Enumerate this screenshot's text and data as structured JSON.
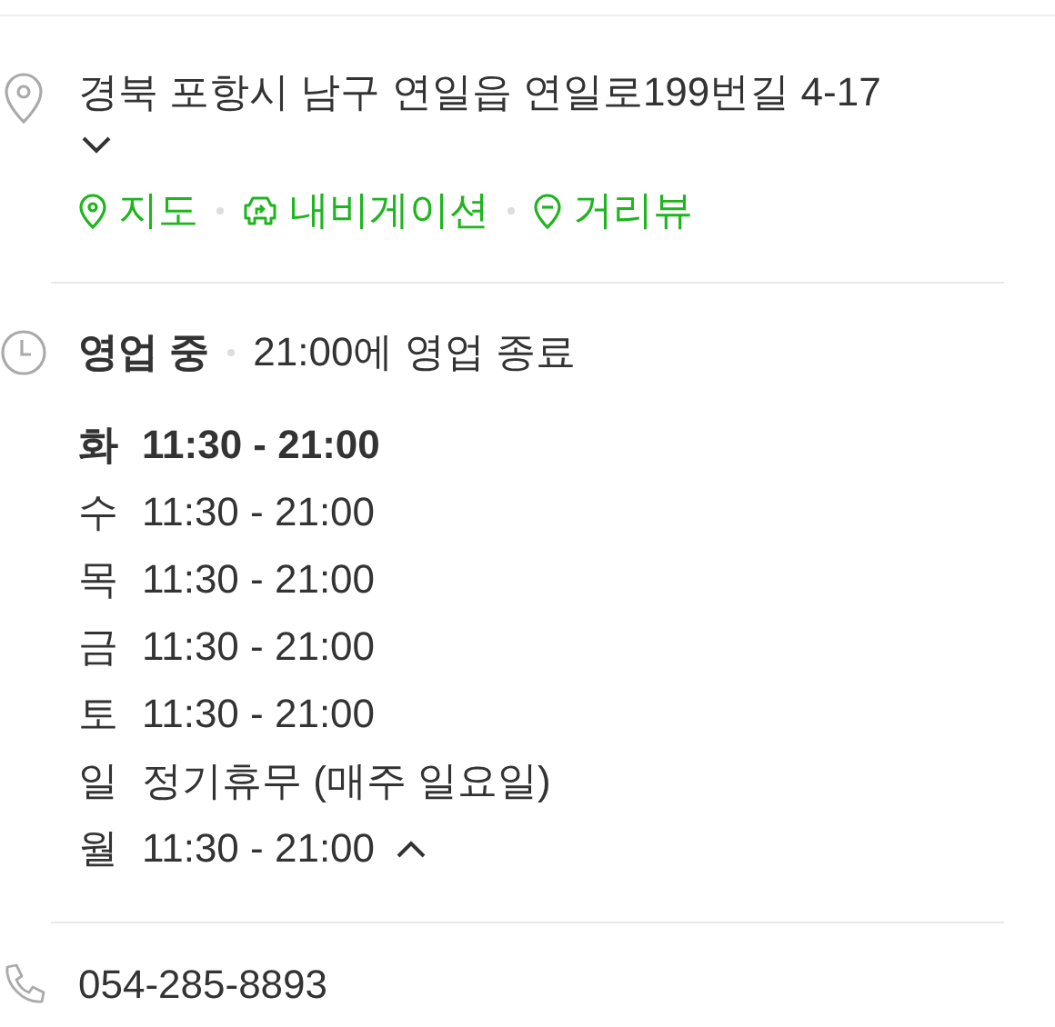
{
  "address": {
    "text": "경북 포항시 남구 연일읍 연일로199번길 4-17",
    "expanded": false
  },
  "links": [
    {
      "kind": "map",
      "label": "지도"
    },
    {
      "kind": "navigation",
      "label": "내비게이션"
    },
    {
      "kind": "streetview",
      "label": "거리뷰"
    }
  ],
  "hours": {
    "status": "영업 중",
    "note": "21:00에 영업 종료",
    "expanded": true,
    "days": [
      {
        "day": "화",
        "time": "11:30 - 21:00",
        "today": true
      },
      {
        "day": "수",
        "time": "11:30 - 21:00",
        "today": false
      },
      {
        "day": "목",
        "time": "11:30 - 21:00",
        "today": false
      },
      {
        "day": "금",
        "time": "11:30 - 21:00",
        "today": false
      },
      {
        "day": "토",
        "time": "11:30 - 21:00",
        "today": false
      },
      {
        "day": "일",
        "time": "정기휴무 (매주 일요일)",
        "today": false
      },
      {
        "day": "월",
        "time": "11:30 - 21:00",
        "today": false
      }
    ]
  },
  "phone": "054-285-8893"
}
